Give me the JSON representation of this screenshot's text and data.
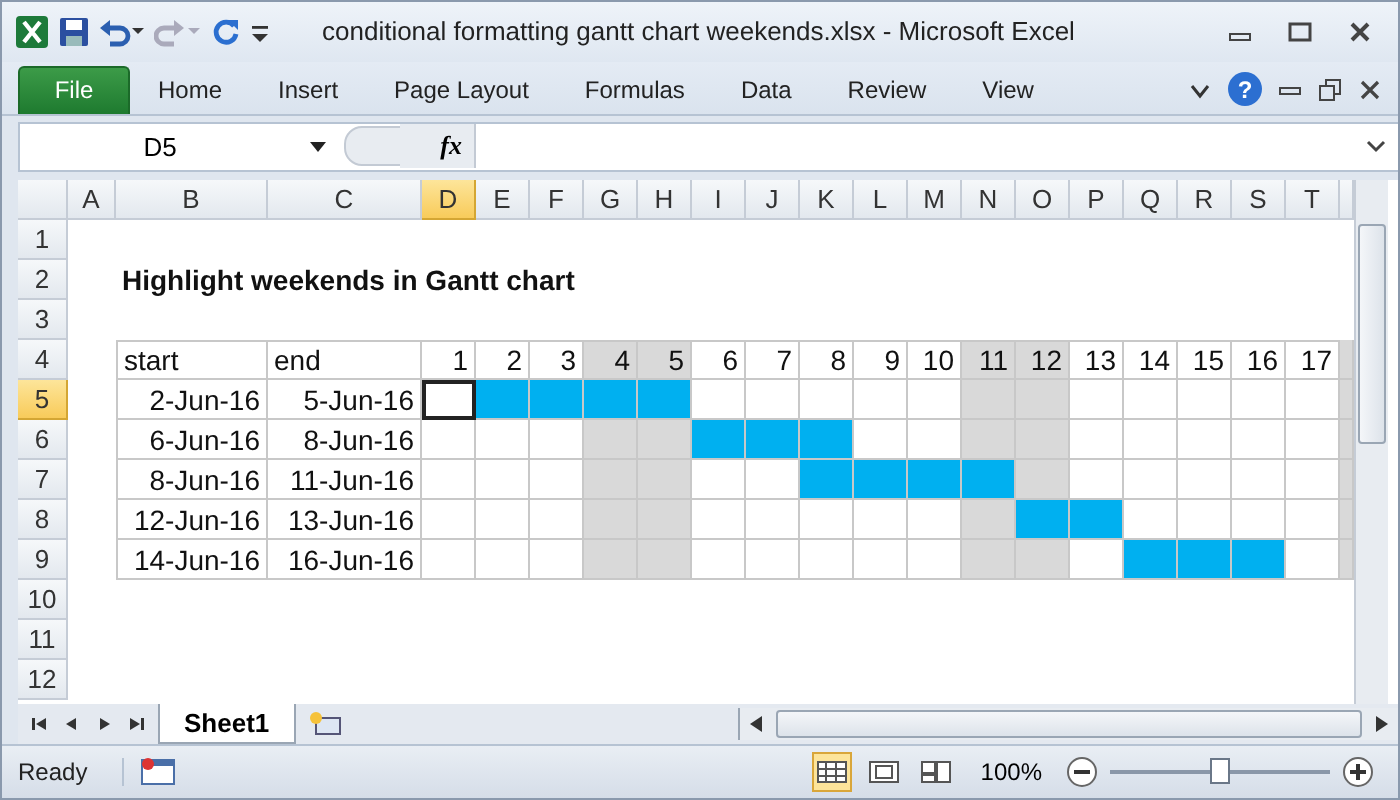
{
  "window": {
    "title": "conditional formatting gantt chart weekends.xlsx  -  Microsoft Excel"
  },
  "ribbon": {
    "tabs": [
      {
        "label": "File",
        "kind": "file"
      },
      {
        "label": "Home",
        "kind": "tab"
      },
      {
        "label": "Insert",
        "kind": "tab"
      },
      {
        "label": "Page Layout",
        "kind": "tab"
      },
      {
        "label": "Formulas",
        "kind": "tab"
      },
      {
        "label": "Data",
        "kind": "tab"
      },
      {
        "label": "Review",
        "kind": "tab"
      },
      {
        "label": "View",
        "kind": "tab"
      }
    ],
    "help": "?"
  },
  "formula_bar": {
    "name_box": "D5",
    "function_label": "fx"
  },
  "columns": [
    {
      "label": "A",
      "selected": false
    },
    {
      "label": "B",
      "selected": false
    },
    {
      "label": "C",
      "selected": false
    },
    {
      "label": "D",
      "selected": true
    },
    {
      "label": "E",
      "selected": false
    },
    {
      "label": "F",
      "selected": false
    },
    {
      "label": "G",
      "selected": false
    },
    {
      "label": "H",
      "selected": false
    },
    {
      "label": "I",
      "selected": false
    },
    {
      "label": "J",
      "selected": false
    },
    {
      "label": "K",
      "selected": false
    },
    {
      "label": "L",
      "selected": false
    },
    {
      "label": "M",
      "selected": false
    },
    {
      "label": "N",
      "selected": false
    },
    {
      "label": "O",
      "selected": false
    },
    {
      "label": "P",
      "selected": false
    },
    {
      "label": "Q",
      "selected": false
    },
    {
      "label": "R",
      "selected": false
    },
    {
      "label": "S",
      "selected": false
    },
    {
      "label": "T",
      "selected": false
    }
  ],
  "rows": [
    {
      "label": "1",
      "selected": false
    },
    {
      "label": "2",
      "selected": false
    },
    {
      "label": "3",
      "selected": false
    },
    {
      "label": "4",
      "selected": false
    },
    {
      "label": "5",
      "selected": true
    },
    {
      "label": "6",
      "selected": false
    },
    {
      "label": "7",
      "selected": false
    },
    {
      "label": "8",
      "selected": false
    },
    {
      "label": "9",
      "selected": false
    },
    {
      "label": "10",
      "selected": false
    },
    {
      "label": "11",
      "selected": false
    },
    {
      "label": "12",
      "selected": false
    }
  ],
  "sheet": {
    "title": "Highlight weekends in Gantt chart",
    "headers": [
      "start",
      "end"
    ],
    "days": [
      {
        "label": "1",
        "weekend": false
      },
      {
        "label": "2",
        "weekend": false
      },
      {
        "label": "3",
        "weekend": false
      },
      {
        "label": "4",
        "weekend": true
      },
      {
        "label": "5",
        "weekend": true
      },
      {
        "label": "6",
        "weekend": false
      },
      {
        "label": "7",
        "weekend": false
      },
      {
        "label": "8",
        "weekend": false
      },
      {
        "label": "9",
        "weekend": false
      },
      {
        "label": "10",
        "weekend": false
      },
      {
        "label": "11",
        "weekend": true
      },
      {
        "label": "12",
        "weekend": true
      },
      {
        "label": "13",
        "weekend": false
      },
      {
        "label": "14",
        "weekend": false
      },
      {
        "label": "15",
        "weekend": false
      },
      {
        "label": "16",
        "weekend": false
      },
      {
        "label": "17",
        "weekend": false
      },
      {
        "weekend": true
      }
    ],
    "tasks": [
      {
        "start": "2-Jun-16",
        "end": "5-Jun-16",
        "filled": [
          false,
          true,
          true,
          true,
          true,
          false,
          false,
          false,
          false,
          false,
          false,
          false,
          false,
          false,
          false,
          false,
          false
        ]
      },
      {
        "start": "6-Jun-16",
        "end": "8-Jun-16",
        "filled": [
          false,
          false,
          false,
          false,
          false,
          true,
          true,
          true,
          false,
          false,
          false,
          false,
          false,
          false,
          false,
          false,
          false
        ]
      },
      {
        "start": "8-Jun-16",
        "end": "11-Jun-16",
        "filled": [
          false,
          false,
          false,
          false,
          false,
          false,
          false,
          true,
          true,
          true,
          true,
          false,
          false,
          false,
          false,
          false,
          false
        ]
      },
      {
        "start": "12-Jun-16",
        "end": "13-Jun-16",
        "filled": [
          false,
          false,
          false,
          false,
          false,
          false,
          false,
          false,
          false,
          false,
          false,
          true,
          true,
          false,
          false,
          false,
          false
        ]
      },
      {
        "start": "14-Jun-16",
        "end": "16-Jun-16",
        "filled": [
          false,
          false,
          false,
          false,
          false,
          false,
          false,
          false,
          false,
          false,
          false,
          false,
          false,
          true,
          true,
          true,
          false
        ]
      }
    ]
  },
  "sheet_tabs": [
    {
      "label": "Sheet1",
      "selected": true
    }
  ],
  "status_bar": {
    "status": "Ready",
    "views": [
      {
        "kind": "normal",
        "selected": true
      },
      {
        "kind": "page-layout",
        "selected": false
      },
      {
        "kind": "page-break",
        "selected": false
      }
    ],
    "zoom": "100%",
    "zoom_slider": {
      "level": 0.5
    }
  }
}
